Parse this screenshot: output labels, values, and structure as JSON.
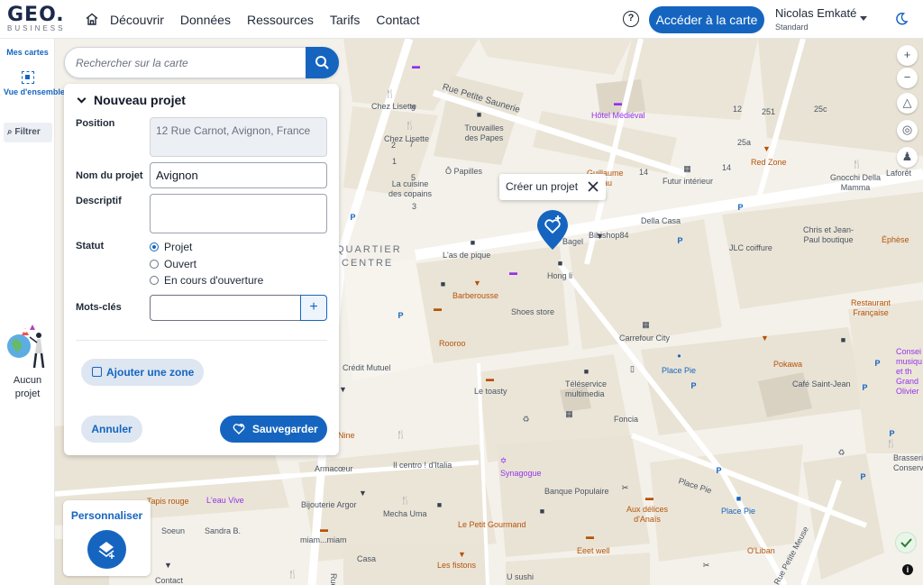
{
  "app": {
    "logo_text": "GEO.",
    "logo_subtext": "BUSINESS"
  },
  "nav": {
    "home_icon": "home-icon",
    "items": [
      "Découvrir",
      "Données",
      "Ressources",
      "Tarifs",
      "Contact"
    ],
    "help_icon": "help-icon",
    "cta_label": "Accéder à la carte",
    "user_name": "Nicolas Emkaté",
    "user_plan": "Standard",
    "theme_icon": "moon-icon"
  },
  "sidebar": {
    "title": "Mes cartes",
    "overview_label": "Vue d'ensemble",
    "filter_label": "Filtrer",
    "empty_label": "Aucun projet"
  },
  "search": {
    "placeholder": "Rechercher sur la carte"
  },
  "panel": {
    "title": "Nouveau projet",
    "position_label": "Position",
    "position_value": "12 Rue Carnot, Avignon, France",
    "name_label": "Nom du projet",
    "name_value": "Avignon",
    "description_label": "Descriptif",
    "description_value": "",
    "status_label": "Statut",
    "status_options": [
      "Projet",
      "Ouvert",
      "En cours d'ouverture"
    ],
    "status_selected": "Projet",
    "keywords_label": "Mots-clés",
    "keywords_value": "",
    "add_zone_label": "Ajouter une zone",
    "cancel_label": "Annuler",
    "save_label": "Sauvegarder"
  },
  "map": {
    "tooltip_label": "Créer un projet",
    "customize_label": "Personnaliser",
    "labels": {
      "rue_petite_saunerie": "Rue Petite Saunerie",
      "chez_lisette_1": "Chez Lisette",
      "chez_lisette_2": "Chez Lisette",
      "trouvailles": "Trouvailles des Papes",
      "hotel_medieval": "Hôtel Médiéval",
      "o_papilles": "Ô Papilles",
      "guillaume": "Guillaume Ciseau",
      "futur_interieur": "Futur intérieur",
      "red_zone": "Red Zone",
      "gnocchi": "Gnocchi Della Mamma",
      "laforet": "Laforêt",
      "la_cuisine": "La cuisine des copains",
      "della_casa": "Della Casa",
      "bibishop": "Bibishop84",
      "bagel": "Bagel",
      "chris": "Chris et Jean-Paul boutique",
      "ephese": "Éphèse",
      "jlc": "JLC coiffure",
      "quartier": "QUARTIER",
      "centre": "CENTRE",
      "as_de_pique": "L'as de pique",
      "hong_li": "Hong li",
      "barberousse": "Barberousse",
      "shoes_store": "Shoes store",
      "restaurant_fr": "Restaurant Française",
      "carrefour": "Carrefour City",
      "rooroo": "Rooroo",
      "credit_mutuel": "Crédit Mutuel",
      "place_pie_1": "Place Pie",
      "pokawa": "Pokawa",
      "cafe_st_jean": "Café Saint-Jean",
      "le_toasty": "Le toasty",
      "teleservice": "Téléservice multimedia",
      "foncia": "Foncia",
      "consei": "Consei musiqu et th Grand Olivier",
      "nine": "Nine",
      "armacoeur": "Armacœur",
      "il_centro": "Il centro ! d'Italia",
      "synagogue": "Synagogue",
      "banque_pop": "Banque Populaire",
      "place_pie_2": "Place Pie",
      "brasserie": "Brasseri Conserv",
      "tapis_rouge": "Tapis rouge",
      "leau_vive": "L'eau Vive",
      "bijouterie": "Bijouterie Argor",
      "mecha_uma": "Mecha Uma",
      "aux_delices": "Aux délices d'Anaïs",
      "place_pie_3": "Place Pie",
      "soeun": "Soeun",
      "sandra": "Sandra B.",
      "miam": "miam...miam",
      "petit_gourmand": "Le Petit Gourmand",
      "eeet_well": "Eeet well",
      "o_liban": "O'Liban",
      "rue_petite_meuse": "Rue Petite Meuse",
      "casa": "Casa",
      "les_fistons": "Les fistons",
      "u_sushi": "U sushi",
      "contact": "Contact",
      "rue": "Rue",
      "nums": [
        "12",
        "251",
        "25c",
        "25a",
        "14",
        "14",
        "9",
        "7",
        "5",
        "3",
        "2",
        "1"
      ]
    }
  },
  "colors": {
    "primary": "#1565c0",
    "map_bg": "#f4f1ea",
    "poi_purple": "#9333ea"
  }
}
